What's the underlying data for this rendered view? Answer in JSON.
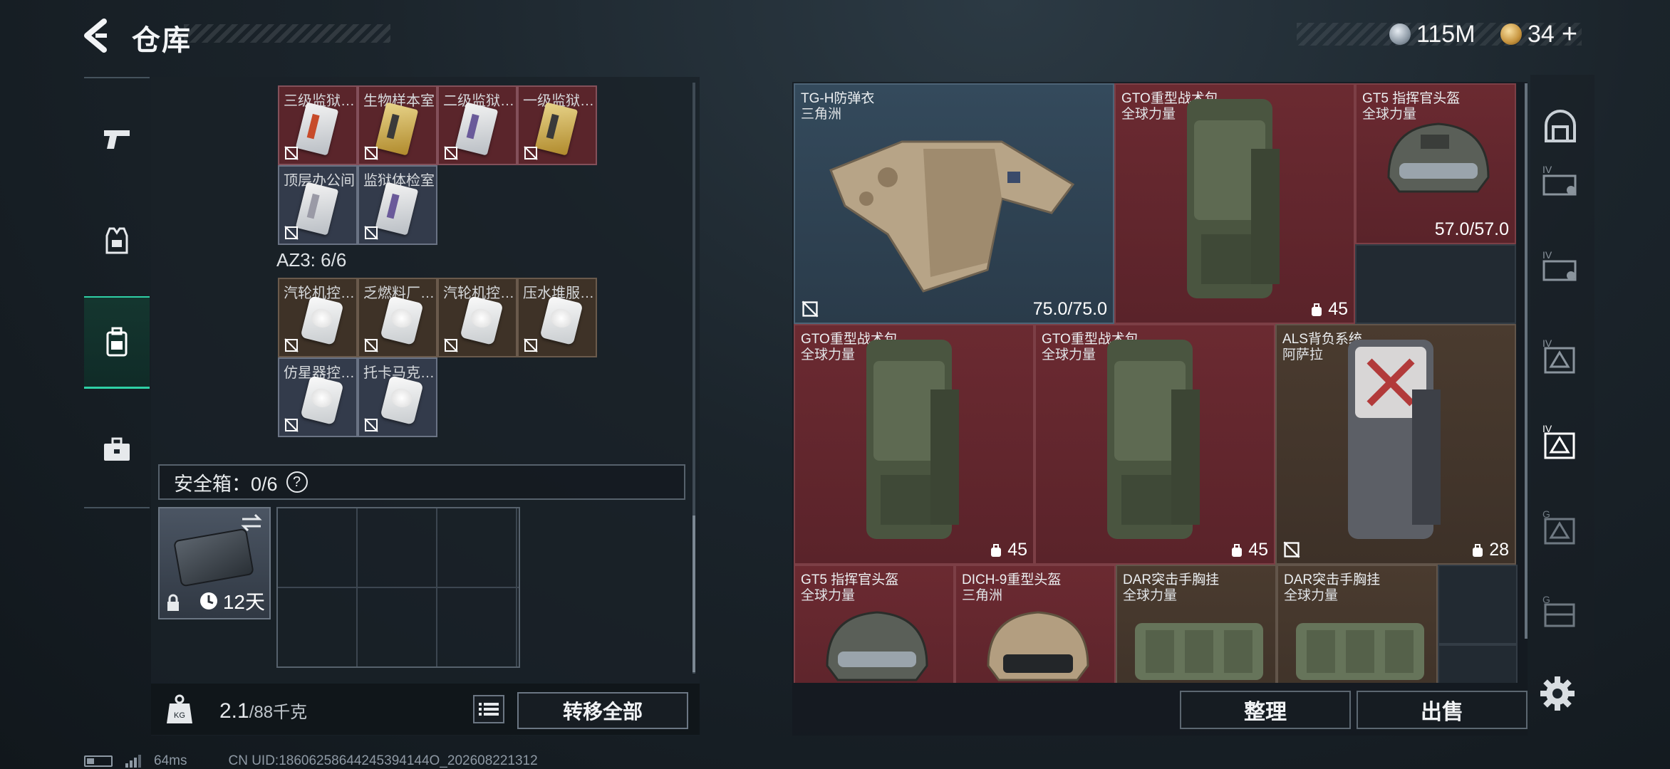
{
  "header": {
    "title": "仓库",
    "currencies": [
      {
        "icon": "silver-coin-icon",
        "value": "115M"
      },
      {
        "icon": "gold-coin-icon",
        "value": "34"
      }
    ],
    "plus_label": "+"
  },
  "left_nav": {
    "items": [
      {
        "icon": "pistol-icon",
        "active": false
      },
      {
        "icon": "armor-vest-icon",
        "active": false
      },
      {
        "icon": "backpack-icon",
        "active": true
      },
      {
        "icon": "toolbox-icon",
        "active": false
      }
    ]
  },
  "keycards": {
    "row1": [
      {
        "name": "三级监狱…",
        "color": "red",
        "card": "red"
      },
      {
        "name": "生物样本室",
        "color": "red",
        "card": "gold"
      },
      {
        "name": "二级监狱…",
        "color": "red",
        "card": "purple"
      },
      {
        "name": "一级监狱…",
        "color": "red",
        "card": "gold"
      }
    ],
    "row2": [
      {
        "name": "顶层办公间",
        "color": "slate",
        "card": "white"
      },
      {
        "name": "监狱体检室",
        "color": "slate",
        "card": "purple"
      }
    ]
  },
  "az3": {
    "label": "AZ3: 6/6"
  },
  "az3_items": {
    "row1": [
      {
        "name": "汽轮机控…",
        "color": "brown"
      },
      {
        "name": "乏燃料厂…",
        "color": "brown"
      },
      {
        "name": "汽轮机控…",
        "color": "brown"
      },
      {
        "name": "压水堆服…",
        "color": "brown"
      }
    ],
    "row2": [
      {
        "name": "仿星器控…",
        "color": "slate"
      },
      {
        "name": "托卡马克…",
        "color": "slate"
      }
    ]
  },
  "safe_box": {
    "label": "安全箱：0/6",
    "help": "?",
    "case_days": "12天"
  },
  "capacity": {
    "current": "2.1",
    "max": "/88千克"
  },
  "buttons": {
    "transfer_all": "转移全部",
    "sort": "整理",
    "sell": "出售"
  },
  "inventory": [
    {
      "name": "TG-H防弹衣",
      "faction": "三角洲",
      "durability": "75.0/75.0",
      "rarity": "blue",
      "art": "vest"
    },
    {
      "name": "GTO重型战术包",
      "faction": "全球力量",
      "capacity": "45",
      "rarity": "red",
      "art": "backpack"
    },
    {
      "name": "GT5 指挥官头盔",
      "faction": "全球力量",
      "durability": "57.0/57.0",
      "rarity": "red",
      "art": "helmet"
    },
    {
      "name": "GTO重型战术包",
      "faction": "全球力量",
      "capacity": "45",
      "rarity": "red",
      "art": "backpack"
    },
    {
      "name": "GTO重型战术包",
      "faction": "全球力量",
      "capacity": "45",
      "rarity": "red",
      "art": "backpack"
    },
    {
      "name": "ALS背负系统",
      "faction": "阿萨拉",
      "capacity": "28",
      "rarity": "brown",
      "art": "backpack-white"
    },
    {
      "name": "GT5 指挥官头盔",
      "faction": "全球力量",
      "rarity": "red",
      "art": "helmet"
    },
    {
      "name": "DICH-9重型头盔",
      "faction": "三角洲",
      "rarity": "red",
      "art": "helmet-tan"
    },
    {
      "name": "DAR突击手胸挂",
      "faction": "全球力量",
      "rarity": "brown",
      "art": "rig"
    },
    {
      "name": "DAR突击手胸挂",
      "faction": "全球力量",
      "rarity": "brown",
      "art": "rig"
    }
  ],
  "right_nav": {
    "items": [
      {
        "icon": "all-items-icon"
      },
      {
        "icon": "tier4-case-icon"
      },
      {
        "icon": "tier4-case-icon"
      },
      {
        "icon": "tier4-container-icon"
      },
      {
        "icon": "tier4-container-icon"
      },
      {
        "icon": "g-container-icon"
      },
      {
        "icon": "g-crate-icon"
      }
    ]
  },
  "footer": {
    "ping": "64ms",
    "uid": "CN UID:18606258644245394144O_202608221312"
  }
}
